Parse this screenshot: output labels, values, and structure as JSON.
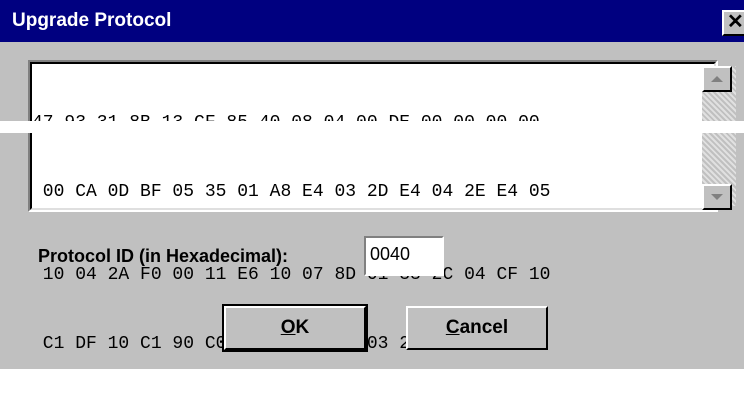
{
  "window": {
    "title": "Upgrade Protocol",
    "close_glyph": "✕"
  },
  "hex_data": {
    "lines": [
      "47 93 31 8B 13 CF 85 40 08 04 00 DE 00 00 00 00",
      " 00 CA 0D BF 05 35 01 A8 E4 03 2D E4 04 2E E4 05",
      " 10 04 2A F0 00 11 E6 10 07 8D 01 33 2C 04 CF 10",
      " C1 DF 10 C1 90 C0 FB 03 B6 C1 03 2A F1 AF"
    ]
  },
  "protocol_id": {
    "label": "Protocol ID (in Hexadecimal):",
    "value": "0040"
  },
  "buttons": {
    "ok_mnemonic": "O",
    "ok_rest": "K",
    "cancel_mnemonic": "C",
    "cancel_rest": "ancel"
  },
  "icons": {
    "scroll_up": "scroll-up-arrow-icon",
    "scroll_down": "scroll-down-arrow-icon"
  }
}
